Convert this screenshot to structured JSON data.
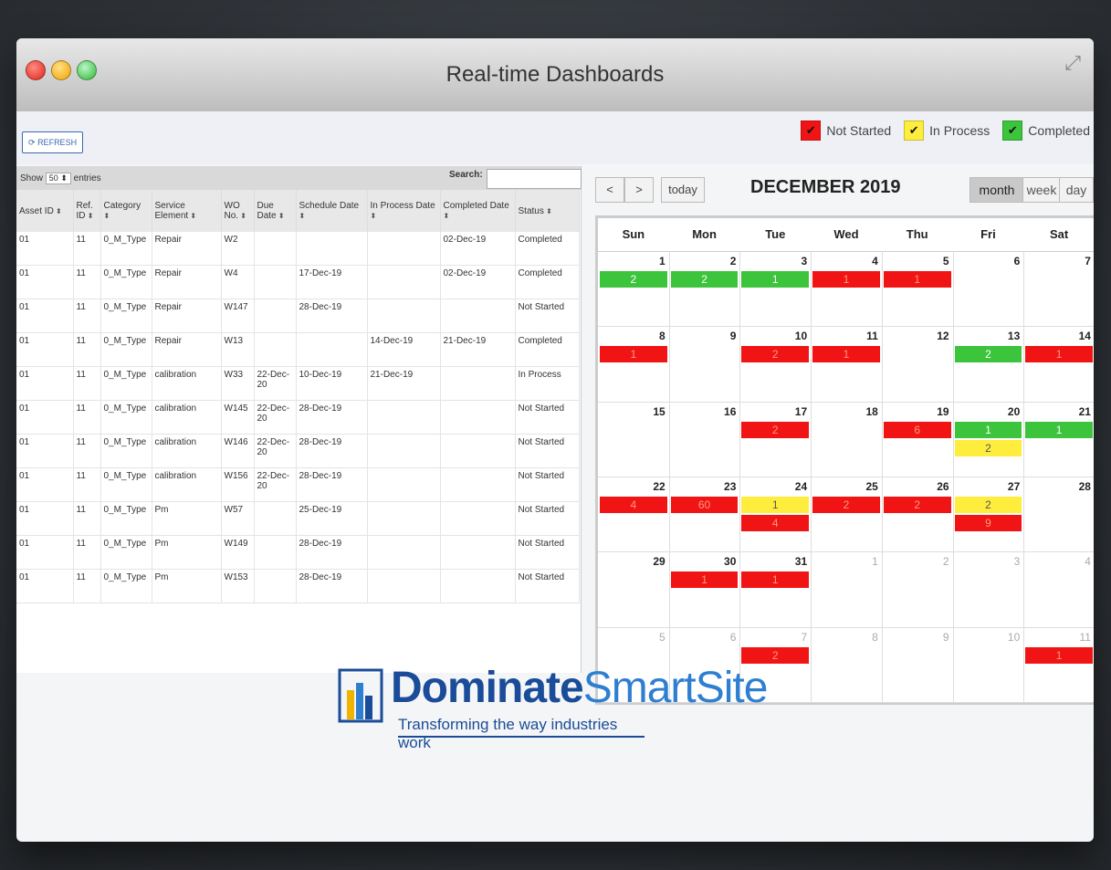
{
  "window": {
    "title": "Real-time Dashboards",
    "expand_icon": "expand-icon"
  },
  "toolbar": {
    "refresh_label": "REFRESH",
    "legend": [
      {
        "label": "Not Started",
        "color": "#f01414"
      },
      {
        "label": "In Process",
        "color": "#ffed3d"
      },
      {
        "label": "Completed",
        "color": "#3cc43c"
      }
    ]
  },
  "table": {
    "show_label": "Show",
    "show_value": "50",
    "entries_label": "entries",
    "search_label": "Search:",
    "search_value": "",
    "columns": [
      "Asset ID",
      "Ref. ID",
      "Category",
      "Service Element",
      "WO No.",
      "Due Date",
      "Schedule Date",
      "In Process Date",
      "Completed Date",
      "Status"
    ],
    "rows": [
      [
        "01",
        "11",
        "0_M_Type",
        "Repair",
        "W2",
        "",
        "",
        "",
        "02-Dec-19",
        "Completed"
      ],
      [
        "01",
        "11",
        "0_M_Type",
        "Repair",
        "W4",
        "",
        "17-Dec-19",
        "",
        "02-Dec-19",
        "Completed"
      ],
      [
        "01",
        "11",
        "0_M_Type",
        "Repair",
        "W147",
        "",
        "28-Dec-19",
        "",
        "",
        "Not Started"
      ],
      [
        "01",
        "11",
        "0_M_Type",
        "Repair",
        "W13",
        "",
        "",
        "14-Dec-19",
        "21-Dec-19",
        "Completed"
      ],
      [
        "01",
        "11",
        "0_M_Type",
        "calibration",
        "W33",
        "22-Dec-20",
        "10-Dec-19",
        "21-Dec-19",
        "",
        "In Process"
      ],
      [
        "01",
        "11",
        "0_M_Type",
        "calibration",
        "W145",
        "22-Dec-20",
        "28-Dec-19",
        "",
        "",
        "Not Started"
      ],
      [
        "01",
        "11",
        "0_M_Type",
        "calibration",
        "W146",
        "22-Dec-20",
        "28-Dec-19",
        "",
        "",
        "Not Started"
      ],
      [
        "01",
        "11",
        "0_M_Type",
        "calibration",
        "W156",
        "22-Dec-20",
        "28-Dec-19",
        "",
        "",
        "Not Started"
      ],
      [
        "01",
        "11",
        "0_M_Type",
        "Pm",
        "W57",
        "",
        "25-Dec-19",
        "",
        "",
        "Not Started"
      ],
      [
        "01",
        "11",
        "0_M_Type",
        "Pm",
        "W149",
        "",
        "28-Dec-19",
        "",
        "",
        "Not Started"
      ],
      [
        "01",
        "11",
        "0_M_Type",
        "Pm",
        "W153",
        "",
        "28-Dec-19",
        "",
        "",
        "Not Started"
      ]
    ]
  },
  "calendar": {
    "prev_label": "<",
    "next_label": ">",
    "today_label": "today",
    "title": "DECEMBER 2019",
    "views": [
      "month",
      "week",
      "day"
    ],
    "active_view": "month",
    "weekdays": [
      "Sun",
      "Mon",
      "Tue",
      "Wed",
      "Thu",
      "Fri",
      "Sat"
    ],
    "weeks": [
      [
        {
          "d": "1",
          "ev": [
            [
              "grn",
              "2"
            ]
          ]
        },
        {
          "d": "2",
          "ev": [
            [
              "grn",
              "2"
            ]
          ]
        },
        {
          "d": "3",
          "ev": [
            [
              "grn",
              "1"
            ]
          ]
        },
        {
          "d": "4",
          "ev": [
            [
              "red",
              "1"
            ]
          ]
        },
        {
          "d": "5",
          "ev": [
            [
              "red",
              "1"
            ]
          ]
        },
        {
          "d": "6",
          "ev": []
        },
        {
          "d": "7",
          "ev": []
        }
      ],
      [
        {
          "d": "8",
          "ev": [
            [
              "red",
              "1"
            ]
          ]
        },
        {
          "d": "9",
          "ev": []
        },
        {
          "d": "10",
          "ev": [
            [
              "red",
              "2"
            ]
          ]
        },
        {
          "d": "11",
          "ev": [
            [
              "red",
              "1"
            ]
          ]
        },
        {
          "d": "12",
          "ev": []
        },
        {
          "d": "13",
          "ev": [
            [
              "grn",
              "2"
            ]
          ]
        },
        {
          "d": "14",
          "ev": [
            [
              "red",
              "1"
            ]
          ]
        }
      ],
      [
        {
          "d": "15",
          "ev": []
        },
        {
          "d": "16",
          "ev": []
        },
        {
          "d": "17",
          "ev": [
            [
              "red",
              "2"
            ]
          ]
        },
        {
          "d": "18",
          "ev": []
        },
        {
          "d": "19",
          "ev": [
            [
              "red",
              "6"
            ]
          ]
        },
        {
          "d": "20",
          "ev": [
            [
              "grn",
              "1"
            ],
            [
              "yel",
              "2"
            ]
          ]
        },
        {
          "d": "21",
          "ev": [
            [
              "grn",
              "1"
            ]
          ]
        }
      ],
      [
        {
          "d": "22",
          "ev": [
            [
              "red",
              "4"
            ]
          ]
        },
        {
          "d": "23",
          "ev": [
            [
              "red",
              "60"
            ]
          ]
        },
        {
          "d": "24",
          "ev": [
            [
              "yel",
              "1"
            ],
            [
              "red",
              "4"
            ]
          ]
        },
        {
          "d": "25",
          "ev": [
            [
              "red",
              "2"
            ]
          ]
        },
        {
          "d": "26",
          "ev": [
            [
              "red",
              "2"
            ]
          ]
        },
        {
          "d": "27",
          "ev": [
            [
              "yel",
              "2"
            ],
            [
              "red",
              "9"
            ]
          ]
        },
        {
          "d": "28",
          "ev": []
        }
      ],
      [
        {
          "d": "29",
          "ev": []
        },
        {
          "d": "30",
          "ev": [
            [
              "red",
              "1"
            ]
          ]
        },
        {
          "d": "31",
          "ev": [
            [
              "red",
              "1"
            ]
          ]
        },
        {
          "d": "1",
          "o": true,
          "ev": []
        },
        {
          "d": "2",
          "o": true,
          "ev": []
        },
        {
          "d": "3",
          "o": true,
          "ev": []
        },
        {
          "d": "4",
          "o": true,
          "ev": []
        }
      ],
      [
        {
          "d": "5",
          "o": true,
          "ev": []
        },
        {
          "d": "6",
          "o": true,
          "ev": []
        },
        {
          "d": "7",
          "o": true,
          "ev": [
            [
              "red",
              "2"
            ]
          ]
        },
        {
          "d": "8",
          "o": true,
          "ev": []
        },
        {
          "d": "9",
          "o": true,
          "ev": []
        },
        {
          "d": "10",
          "o": true,
          "ev": []
        },
        {
          "d": "11",
          "o": true,
          "ev": [
            [
              "red",
              "1"
            ]
          ]
        }
      ]
    ]
  },
  "logo": {
    "name_part1": "Dominate",
    "name_part2": "SmartSite",
    "tagline": "Transforming the way industries work"
  }
}
